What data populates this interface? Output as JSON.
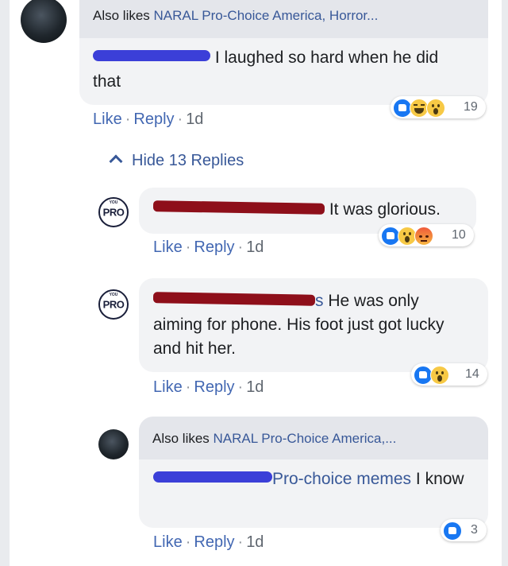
{
  "comments": [
    {
      "also_likes_prefix": "Also likes ",
      "also_likes_pages": "NARAL Pro-Choice America, Horror...",
      "text": "I laughed so hard when he did that",
      "reaction_count": "19",
      "reactions": [
        "like-icon",
        "haha-icon",
        "wow-icon"
      ],
      "actions": {
        "like": "Like",
        "sep": "·",
        "reply": "Reply",
        "time": "1d"
      }
    }
  ],
  "hide_replies": {
    "label": "Hide 13 Replies",
    "icon": "chevron-up-icon"
  },
  "replies": [
    {
      "avatar_text": "PRO",
      "avatar_arc": "YOU",
      "text": "It was glorious.",
      "reaction_count": "10",
      "reactions": [
        "like-icon",
        "wow-icon",
        "angry-icon"
      ],
      "actions": {
        "like": "Like",
        "sep": "·",
        "reply": "Reply",
        "time": "1d"
      }
    },
    {
      "avatar_text": "PRO",
      "avatar_arc": "YOU",
      "name_tail": "s",
      "text": "He was only aiming for phone. His foot just got lucky and hit her.",
      "reaction_count": "14",
      "reactions": [
        "like-icon",
        "wow-icon"
      ],
      "actions": {
        "like": "Like",
        "sep": "·",
        "reply": "Reply",
        "time": "1d"
      }
    },
    {
      "also_likes_prefix": "Also likes ",
      "also_likes_pages": "NARAL Pro-Choice America,...",
      "mention": "Pro-choice memes",
      "text": " I know",
      "reaction_count": "3",
      "reactions": [
        "like-icon"
      ],
      "actions": {
        "like": "Like",
        "sep": "·",
        "reply": "Reply",
        "time": "1d"
      }
    }
  ],
  "colors": {
    "link": "#385898",
    "bubble": "#f2f3f5",
    "like_blue": "#1877f2",
    "redaction_blue": "#3b3fd8",
    "redaction_red": "#8e0f1a"
  }
}
